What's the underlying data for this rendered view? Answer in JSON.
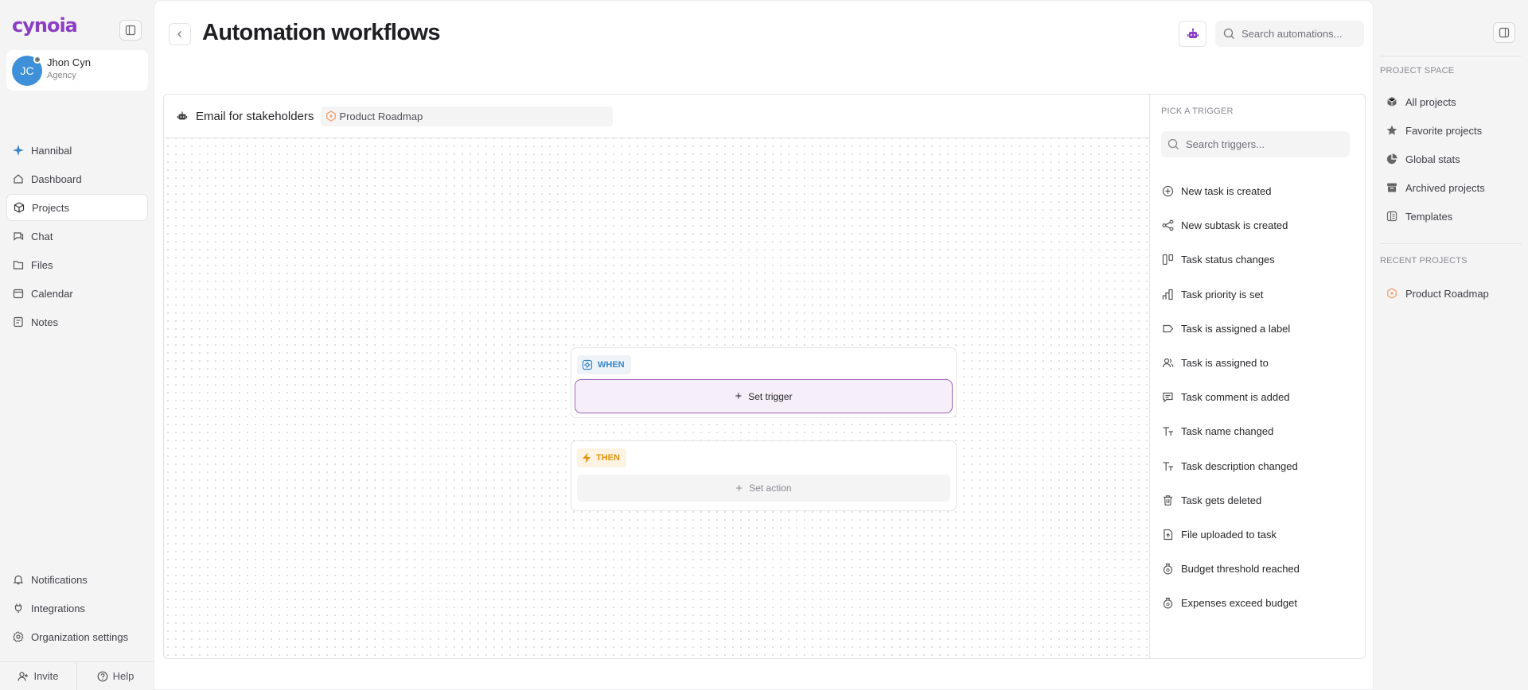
{
  "app": {
    "logo": "cynoia"
  },
  "user": {
    "initials": "JC",
    "name": "Jhon Cyn",
    "role": "Agency"
  },
  "sidebar": {
    "items": [
      {
        "label": "Hannibal",
        "icon": "sparkle-icon"
      },
      {
        "label": "Dashboard",
        "icon": "home-icon"
      },
      {
        "label": "Projects",
        "icon": "cube-icon",
        "active": true
      },
      {
        "label": "Chat",
        "icon": "chat-icon"
      },
      {
        "label": "Files",
        "icon": "files-icon"
      },
      {
        "label": "Calendar",
        "icon": "calendar-icon"
      },
      {
        "label": "Notes",
        "icon": "notes-icon"
      }
    ],
    "bottom_items": [
      {
        "label": "Notifications",
        "icon": "bell-icon"
      },
      {
        "label": "Integrations",
        "icon": "plug-icon"
      },
      {
        "label": "Organization settings",
        "icon": "gear-icon"
      }
    ],
    "invite_label": "Invite",
    "help_label": "Help"
  },
  "header": {
    "title": "Automation workflows",
    "search_placeholder": "Search automations..."
  },
  "workflow": {
    "name": "Email for stakeholders",
    "project": "Product Roadmap",
    "when_label": "WHEN",
    "set_trigger_label": "Set trigger",
    "then_label": "THEN",
    "set_action_label": "Set action"
  },
  "trigger_panel": {
    "heading": "PICK A TRIGGER",
    "search_placeholder": "Search triggers...",
    "items": [
      {
        "label": "New task is created",
        "icon": "plus-circle-icon"
      },
      {
        "label": "New subtask is created",
        "icon": "subtask-icon"
      },
      {
        "label": "Task status changes",
        "icon": "columns-icon"
      },
      {
        "label": "Task priority is set",
        "icon": "bar-chart-icon"
      },
      {
        "label": "Task is assigned a label",
        "icon": "label-icon"
      },
      {
        "label": "Task is assigned to",
        "icon": "users-icon"
      },
      {
        "label": "Task comment is added",
        "icon": "comment-icon"
      },
      {
        "label": "Task name changed",
        "icon": "text-icon"
      },
      {
        "label": "Task description changed",
        "icon": "text-icon"
      },
      {
        "label": "Task gets deleted",
        "icon": "trash-icon"
      },
      {
        "label": "File uploaded to task",
        "icon": "file-upload-icon"
      },
      {
        "label": "Budget threshold reached",
        "icon": "money-bag-icon"
      },
      {
        "label": "Expenses exceed budget",
        "icon": "money-bag-icon"
      }
    ]
  },
  "right_panel": {
    "project_space_heading": "PROJECT SPACE",
    "project_space_items": [
      {
        "label": "All projects",
        "icon": "cube-icon"
      },
      {
        "label": "Favorite projects",
        "icon": "star-icon"
      },
      {
        "label": "Global stats",
        "icon": "pie-chart-icon"
      },
      {
        "label": "Archived projects",
        "icon": "archive-icon"
      },
      {
        "label": "Templates",
        "icon": "template-icon"
      }
    ],
    "recent_heading": "RECENT PROJECTS",
    "recent_items": [
      {
        "label": "Product Roadmap",
        "icon": "project-hex-icon"
      }
    ]
  },
  "colors": {
    "brand": "#8b3fc2",
    "accent_when": "#3a86c8",
    "accent_then": "#e3950c",
    "avatar": "#3e90d8"
  }
}
